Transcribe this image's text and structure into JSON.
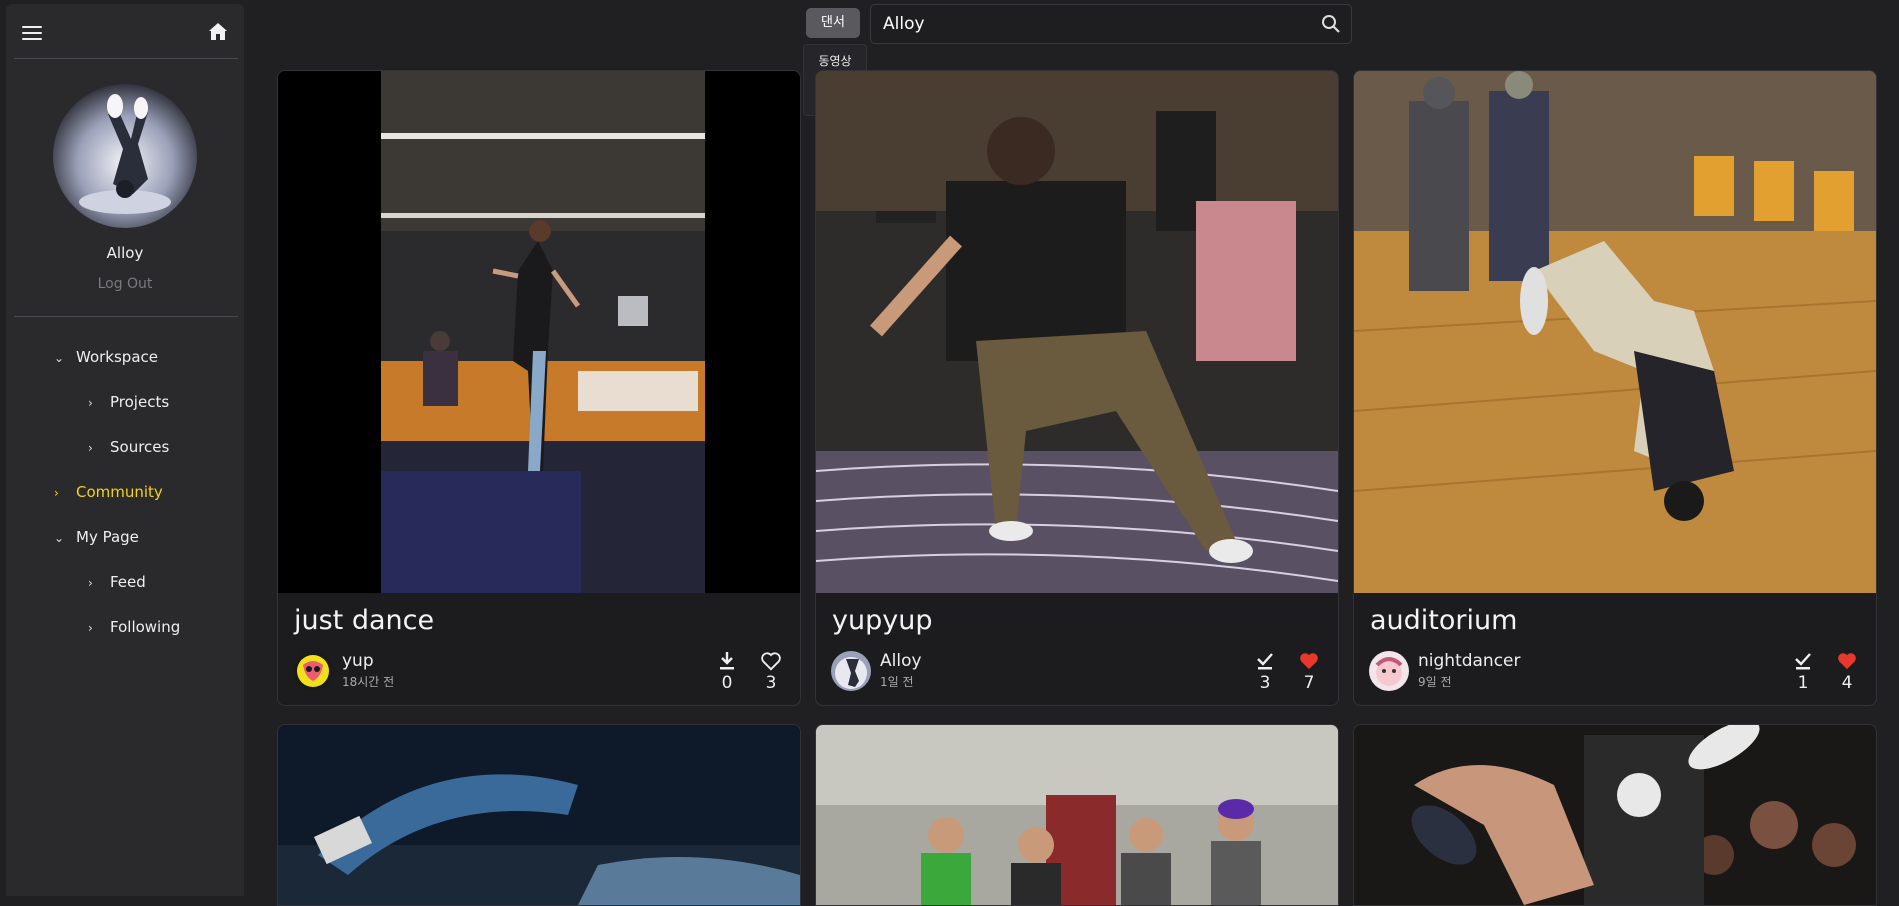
{
  "sidebar": {
    "user_name": "Alloy",
    "logout_label": "Log Out",
    "nav": {
      "workspace": "Workspace",
      "projects": "Projects",
      "sources": "Sources",
      "community": "Community",
      "mypage": "My Page",
      "feed": "Feed",
      "following": "Following"
    }
  },
  "search": {
    "category_selected": "댄서",
    "category_options": [
      "동영상",
      "댄서"
    ],
    "query": "Alloy"
  },
  "colors": {
    "accent": "#f2d21c",
    "liked": "#e8372b",
    "background": "#202023",
    "sidebar": "#2a2a2d"
  },
  "cards": [
    {
      "title": "just dance",
      "user": "yup",
      "time": "18시간 전",
      "stat1_icon": "download-icon",
      "stat1": "0",
      "stat2_icon": "heart-outline-icon",
      "stat2": "3"
    },
    {
      "title": "yupyup",
      "user": "Alloy",
      "time": "1일 전",
      "stat1_icon": "check-icon",
      "stat1": "3",
      "stat2_icon": "heart-filled-icon",
      "stat2": "7"
    },
    {
      "title": "auditorium",
      "user": "nightdancer",
      "time": "9일 전",
      "stat1_icon": "check-icon",
      "stat1": "1",
      "stat2_icon": "heart-filled-icon",
      "stat2": "4"
    }
  ]
}
